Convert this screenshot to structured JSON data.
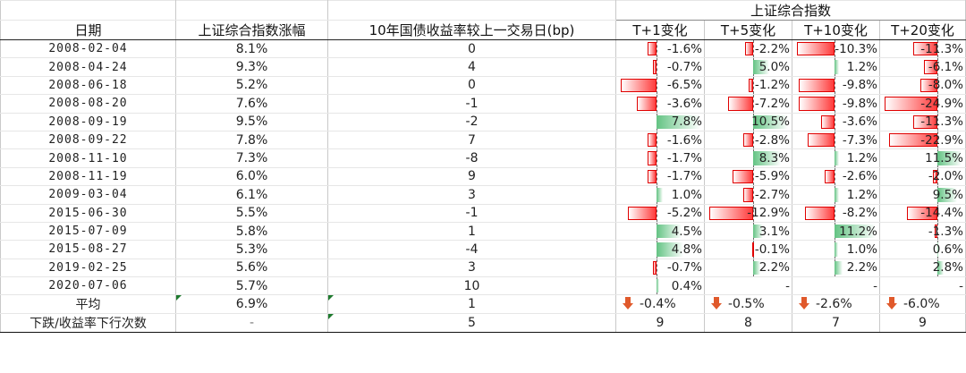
{
  "header": {
    "group_label": "上证综合指数",
    "col_date": "日期",
    "col_rise": "上证综合指数涨幅",
    "col_bond": "10年国债收益率较上一交易日(bp)",
    "col_t1": "T+1变化",
    "col_t5": "T+5变化",
    "col_t10": "T+10变化",
    "col_t20": "T+20变化"
  },
  "rows": [
    {
      "date": "2008-02-04",
      "rise": "8.1%",
      "bond": "0",
      "t1": "-1.6%",
      "t5": "-2.2%",
      "t10": "-10.3%",
      "t20": "-11.3%"
    },
    {
      "date": "2008-04-24",
      "rise": "9.3%",
      "bond": "4",
      "t1": "-0.7%",
      "t5": "5.0%",
      "t10": "1.2%",
      "t20": "-6.1%"
    },
    {
      "date": "2008-06-18",
      "rise": "5.2%",
      "bond": "0",
      "t1": "-6.5%",
      "t5": "-1.2%",
      "t10": "-9.8%",
      "t20": "-8.0%"
    },
    {
      "date": "2008-08-20",
      "rise": "7.6%",
      "bond": "-1",
      "t1": "-3.6%",
      "t5": "-7.2%",
      "t10": "-9.8%",
      "t20": "-24.9%"
    },
    {
      "date": "2008-09-19",
      "rise": "9.5%",
      "bond": "-2",
      "t1": "7.8%",
      "t5": "10.5%",
      "t10": "-3.6%",
      "t20": "-11.3%"
    },
    {
      "date": "2008-09-22",
      "rise": "7.8%",
      "bond": "7",
      "t1": "-1.6%",
      "t5": "-2.8%",
      "t10": "-7.3%",
      "t20": "-22.9%"
    },
    {
      "date": "2008-11-10",
      "rise": "7.3%",
      "bond": "-8",
      "t1": "-1.7%",
      "t5": "8.3%",
      "t10": "1.2%",
      "t20": "11.5%"
    },
    {
      "date": "2008-11-19",
      "rise": "6.0%",
      "bond": "9",
      "t1": "-1.7%",
      "t5": "-5.9%",
      "t10": "-2.6%",
      "t20": "-2.0%"
    },
    {
      "date": "2009-03-04",
      "rise": "6.1%",
      "bond": "3",
      "t1": "1.0%",
      "t5": "-2.7%",
      "t10": "1.2%",
      "t20": "9.5%"
    },
    {
      "date": "2015-06-30",
      "rise": "5.5%",
      "bond": "-1",
      "t1": "-5.2%",
      "t5": "-12.9%",
      "t10": "-8.2%",
      "t20": "-14.4%"
    },
    {
      "date": "2015-07-09",
      "rise": "5.8%",
      "bond": "1",
      "t1": "4.5%",
      "t5": "3.1%",
      "t10": "11.2%",
      "t20": "-1.3%"
    },
    {
      "date": "2015-08-27",
      "rise": "5.3%",
      "bond": "-4",
      "t1": "4.8%",
      "t5": "-0.1%",
      "t10": "1.0%",
      "t20": "0.6%"
    },
    {
      "date": "2019-02-25",
      "rise": "5.6%",
      "bond": "3",
      "t1": "-0.7%",
      "t5": "2.2%",
      "t10": "2.2%",
      "t20": "2.8%"
    },
    {
      "date": "2020-07-06",
      "rise": "5.7%",
      "bond": "10",
      "t1": "0.4%",
      "t5": "-",
      "t10": "-",
      "t20": "-"
    }
  ],
  "avg": {
    "label": "平均",
    "rise": "6.9%",
    "bond": "1",
    "t1": "-0.4%",
    "t5": "-0.5%",
    "t10": "-2.6%",
    "t20": "-6.0%",
    "icon": "arrow-down-icon"
  },
  "count": {
    "label": "下跌/收益率下行次数",
    "rise": "-",
    "bond": "5",
    "t1": "9",
    "t5": "8",
    "t10": "7",
    "t20": "9"
  },
  "colors": {
    "neg": "#ff3b3b",
    "pos": "#63c383",
    "arrow": "#e0592b"
  }
}
